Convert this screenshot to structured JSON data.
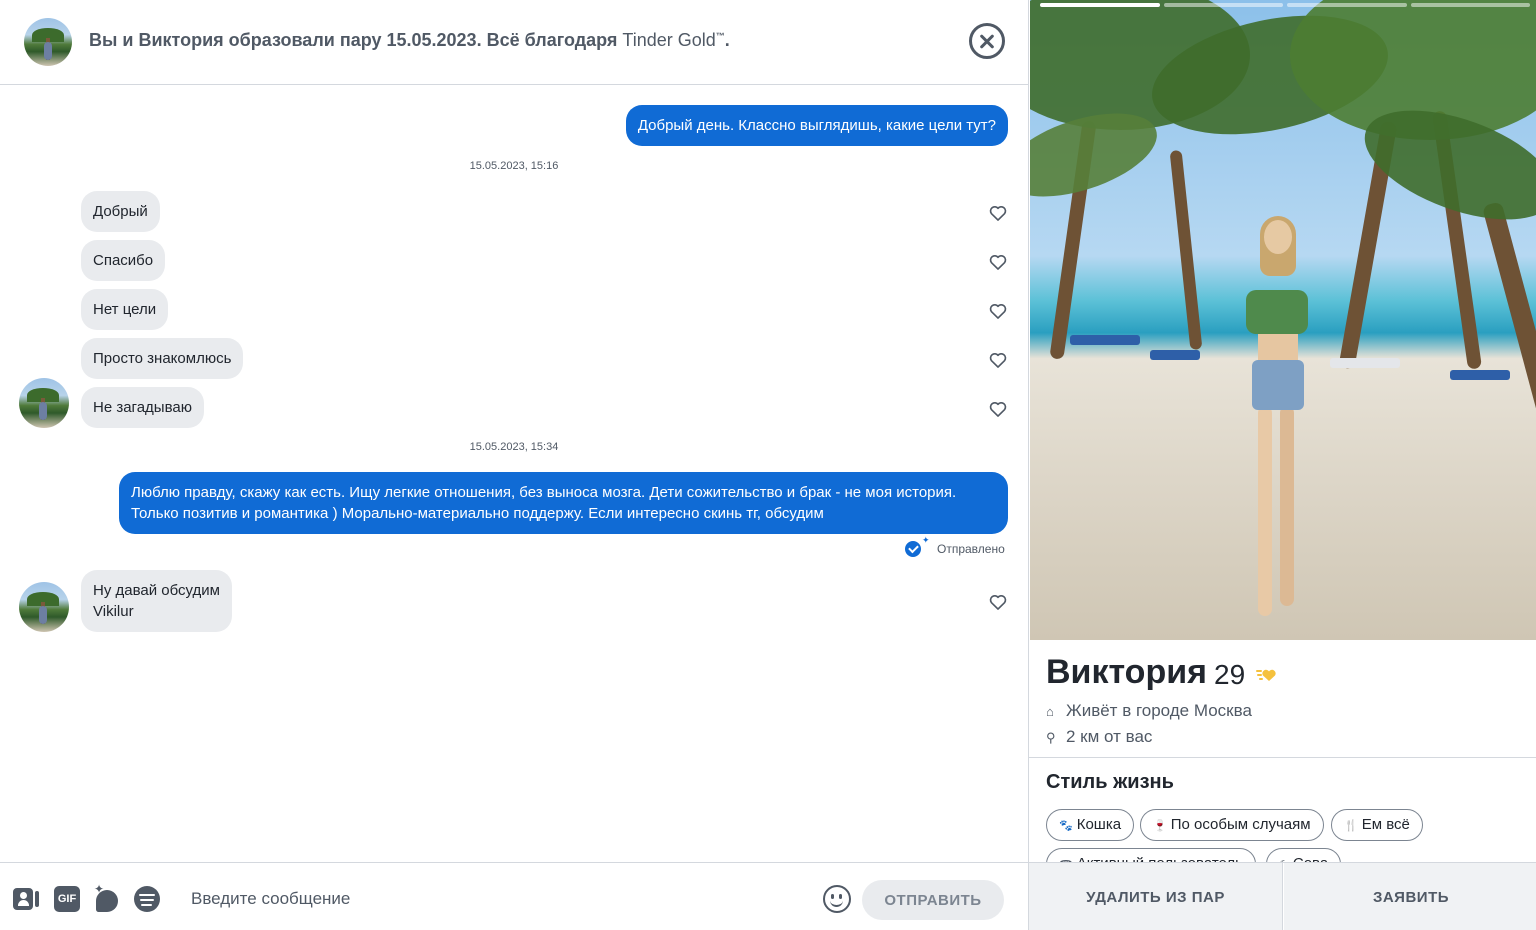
{
  "header": {
    "match_text": "Вы и Виктория образовали пару 15.05.2023. Всё благодаря ",
    "brand": "Tinder Gold",
    "brand_mark": "™",
    "brand_suffix": "."
  },
  "messages": {
    "out_1": "Добрый день. Классно выглядишь, какие цели тут?",
    "timestamp_1": "15.05.2023, 15:16",
    "in_1": "Добрый",
    "in_2": "Спасибо",
    "in_3": "Нет цели",
    "in_4": "Просто знакомлюсь",
    "in_5": "Не загадываю",
    "timestamp_2": "15.05.2023, 15:34",
    "out_2": "Люблю правду, скажу как есть. Ищу легкие отношения, без выноса мозга. Дети сожительство и брак - не моя история. Только позитив и романтика ) Морально-материально поддержу. Если интересно скинь тг, обсудим",
    "sent_status": "Отправлено",
    "in_6_line1": "Ну давай обсудим",
    "in_6_line2": "Vikilur"
  },
  "composer": {
    "gif_label": "GIF",
    "placeholder": "Введите сообщение",
    "send_label": "ОТПРАВИТЬ"
  },
  "profile": {
    "name": "Виктория",
    "age": "29",
    "city": "Живёт в городе Москва",
    "distance": "2 км от вас",
    "lifestyle_title": "Стиль жизнь",
    "chips": [
      "Кошка",
      "По особым случаям",
      "Ем всё",
      "Активный пользователь",
      "Сова"
    ],
    "photo_progress": {
      "total": 4,
      "current": 1
    }
  },
  "actions": {
    "unmatch_label": "УДАЛИТЬ ИЗ ПАР",
    "report_label": "ЗАЯВИТЬ"
  },
  "colors": {
    "accent": "#106bd5",
    "incoming_bubble": "#e9ebee",
    "text_secondary": "#505965"
  }
}
